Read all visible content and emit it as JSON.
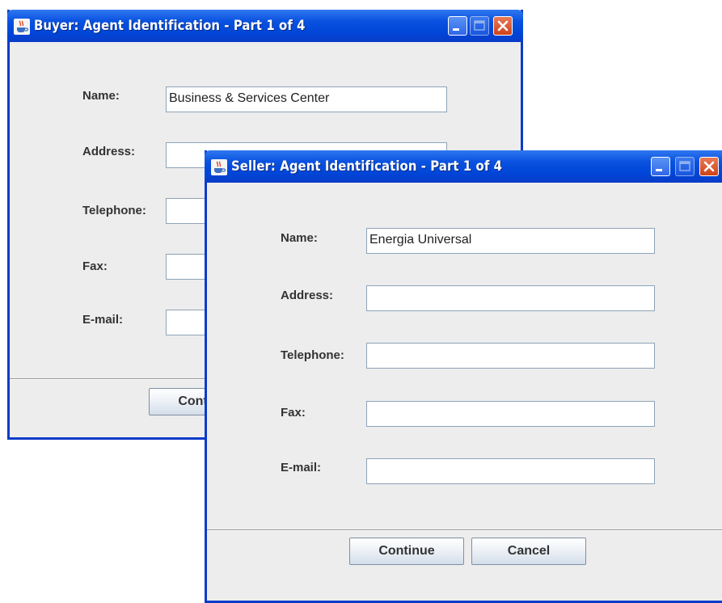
{
  "buyer": {
    "title": "Buyer: Agent Identification - Part 1 of 4",
    "labels": {
      "name": "Name:",
      "address": "Address:",
      "telephone": "Telephone:",
      "fax": "Fax:",
      "email": "E-mail:"
    },
    "values": {
      "name": "Business & Services Center",
      "address": "",
      "telephone": "",
      "fax": "",
      "email": ""
    },
    "continue_label": "Continue"
  },
  "seller": {
    "title": "Seller: Agent Identification - Part 1 of 4",
    "labels": {
      "name": "Name:",
      "address": "Address:",
      "telephone": "Telephone:",
      "fax": "Fax:",
      "email": "E-mail:"
    },
    "values": {
      "name": "Energia Universal",
      "address": "",
      "telephone": "",
      "fax": "",
      "email": ""
    },
    "continue_label": "Continue",
    "cancel_label": "Cancel"
  },
  "icons": {
    "app": "java-coffee-cup-icon",
    "minimize": "minimize-icon",
    "maximize": "maximize-icon",
    "close": "close-icon"
  },
  "colors": {
    "titlebar": "#0a52e0",
    "window_border": "#0a3cc8",
    "close_button": "#cf4317",
    "window_background": "#ededed"
  }
}
